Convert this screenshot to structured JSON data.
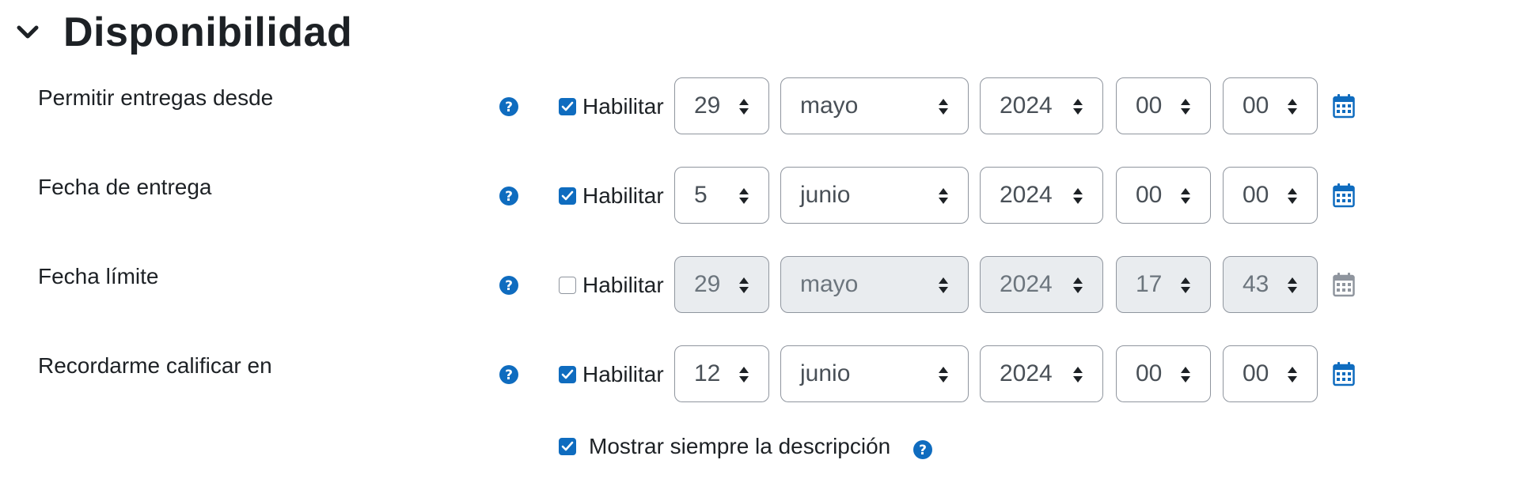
{
  "section": {
    "title": "Disponibilidad"
  },
  "colors": {
    "accent": "#0f6cbf",
    "help": "#0f6cbf",
    "disabled_bg": "#e9ecef"
  },
  "icons": {
    "help": "question-circle-icon",
    "calendar": "calendar-icon",
    "collapse": "chevron-down-icon",
    "select": "sort-arrows-icon"
  },
  "rows": [
    {
      "label": "Permitir entregas desde",
      "enable_label": "Habilitar",
      "enabled": true,
      "day": "29",
      "month": "mayo",
      "year": "2024",
      "hour": "00",
      "minute": "00"
    },
    {
      "label": "Fecha de entrega",
      "enable_label": "Habilitar",
      "enabled": true,
      "day": "5",
      "month": "junio",
      "year": "2024",
      "hour": "00",
      "minute": "00"
    },
    {
      "label": "Fecha límite",
      "enable_label": "Habilitar",
      "enabled": false,
      "day": "29",
      "month": "mayo",
      "year": "2024",
      "hour": "17",
      "minute": "43"
    },
    {
      "label": "Recordarme calificar en",
      "enable_label": "Habilitar",
      "enabled": true,
      "day": "12",
      "month": "junio",
      "year": "2024",
      "hour": "00",
      "minute": "00"
    }
  ],
  "always_show": {
    "label": "Mostrar siempre la descripción",
    "checked": true
  }
}
